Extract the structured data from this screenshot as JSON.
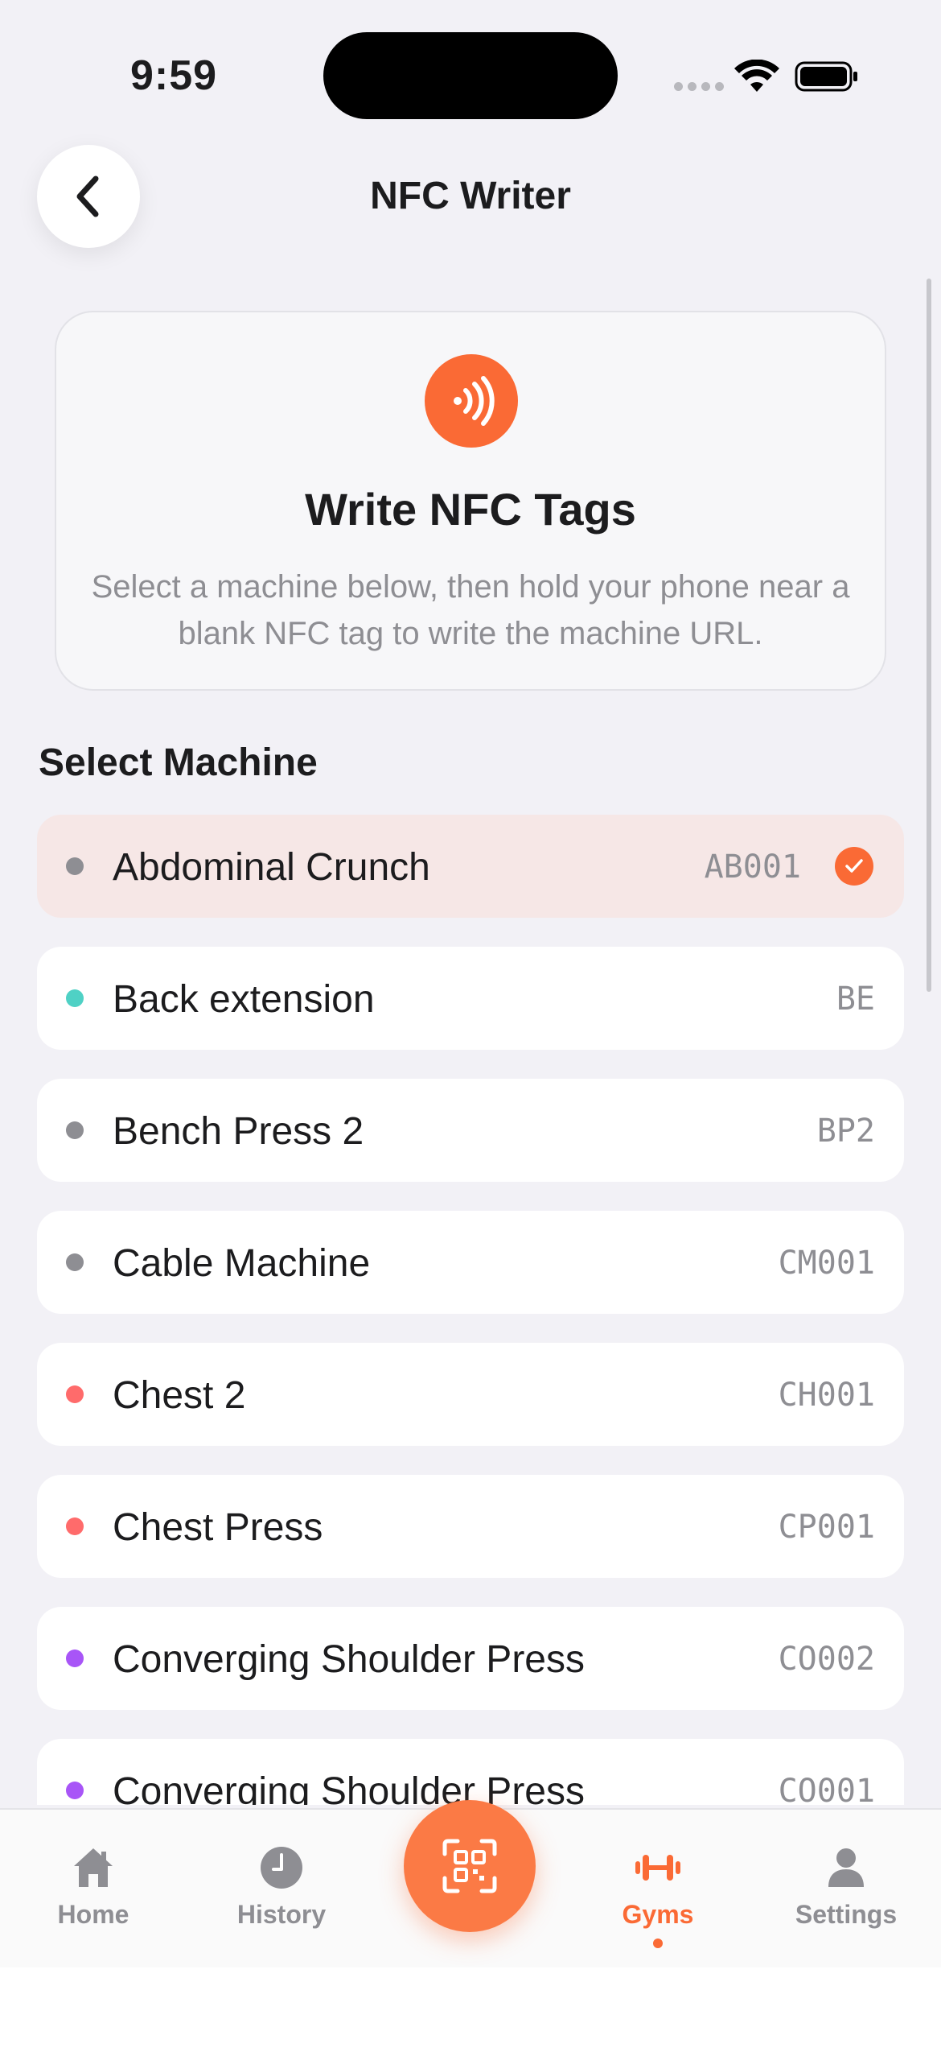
{
  "status_bar": {
    "time": "9:59"
  },
  "header": {
    "title": "NFC Writer",
    "back_icon": "chevron-left-icon"
  },
  "info_card": {
    "icon": "nfc-waves-icon",
    "title": "Write NFC Tags",
    "description": "Select a machine below, then hold your phone near a blank NFC tag to write the machine URL."
  },
  "section": {
    "title": "Select Machine"
  },
  "machines": [
    {
      "name": "Abdominal Crunch",
      "code": "AB001",
      "dot_color": "#8e8e93",
      "selected": true
    },
    {
      "name": "Back extension",
      "code": "BE",
      "dot_color": "#4fd1c5",
      "selected": false
    },
    {
      "name": "Bench Press 2",
      "code": "BP2",
      "dot_color": "#8e8e93",
      "selected": false
    },
    {
      "name": "Cable Machine",
      "code": "CM001",
      "dot_color": "#8e8e93",
      "selected": false
    },
    {
      "name": "Chest 2",
      "code": "CH001",
      "dot_color": "#ff6b6b",
      "selected": false
    },
    {
      "name": "Chest Press",
      "code": "CP001",
      "dot_color": "#ff6b6b",
      "selected": false
    },
    {
      "name": "Converging Shoulder Press",
      "code": "CO002",
      "dot_color": "#a855f7",
      "selected": false
    },
    {
      "name": "Converging Shoulder Press",
      "code": "CO001",
      "dot_color": "#a855f7",
      "selected": false
    }
  ],
  "tab_bar": {
    "tabs": [
      {
        "label": "Home",
        "icon": "home-icon"
      },
      {
        "label": "History",
        "icon": "clock-icon"
      },
      {
        "label": "Gyms",
        "icon": "dumbbell-icon",
        "active": true
      },
      {
        "label": "Settings",
        "icon": "person-icon"
      }
    ],
    "center_button_icon": "qr-scan-icon"
  },
  "colors": {
    "accent": "#fa6a35",
    "background": "#f2f1f6",
    "selected_row": "#f6e7e6"
  }
}
